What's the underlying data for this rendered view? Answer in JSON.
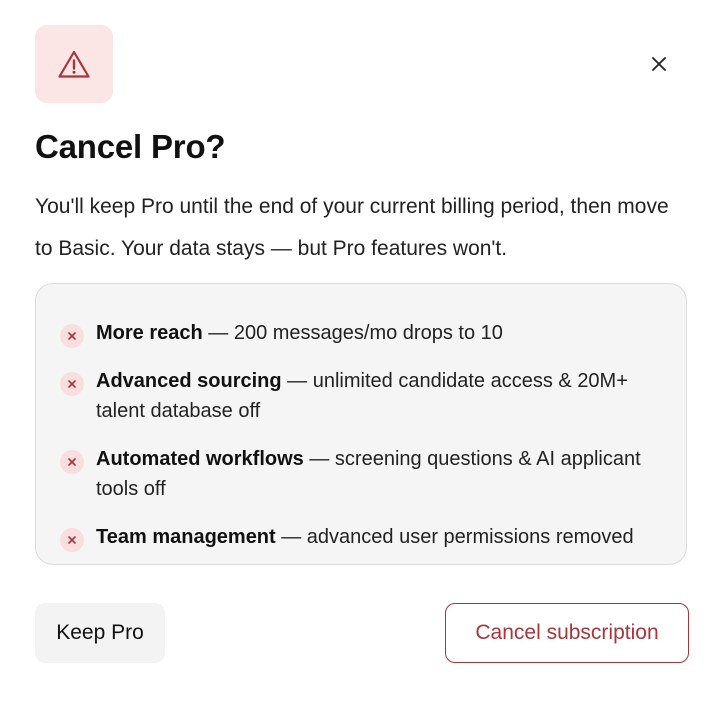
{
  "dialog": {
    "warning_icon": "warning-triangle-icon",
    "close_icon": "close-icon",
    "title": "Cancel Pro?",
    "description": "You'll keep Pro until the end of your current billing period, then move to Basic. Your data stays — but Pro features won't.",
    "losses": [
      {
        "icon": "x-icon",
        "title": "More reach",
        "detail": " — 200 messages/mo drops to 10"
      },
      {
        "icon": "x-icon",
        "title": "Advanced sourcing",
        "detail": " — unlimited candidate access & 20M+ talent database off"
      },
      {
        "icon": "x-icon",
        "title": "Automated workflows",
        "detail": " — screening questions & AI applicant tools off"
      },
      {
        "icon": "x-icon",
        "title": "Team management",
        "detail": " — advanced user permissions removed"
      }
    ],
    "keep_label": "Keep Pro",
    "cancel_label": "Cancel subscription"
  },
  "colors": {
    "accent_red": "#a8353a",
    "warning_bg": "#fbe5e5",
    "panel_bg": "#f5f5f5",
    "neutral_button_bg": "#f3f3f3"
  }
}
